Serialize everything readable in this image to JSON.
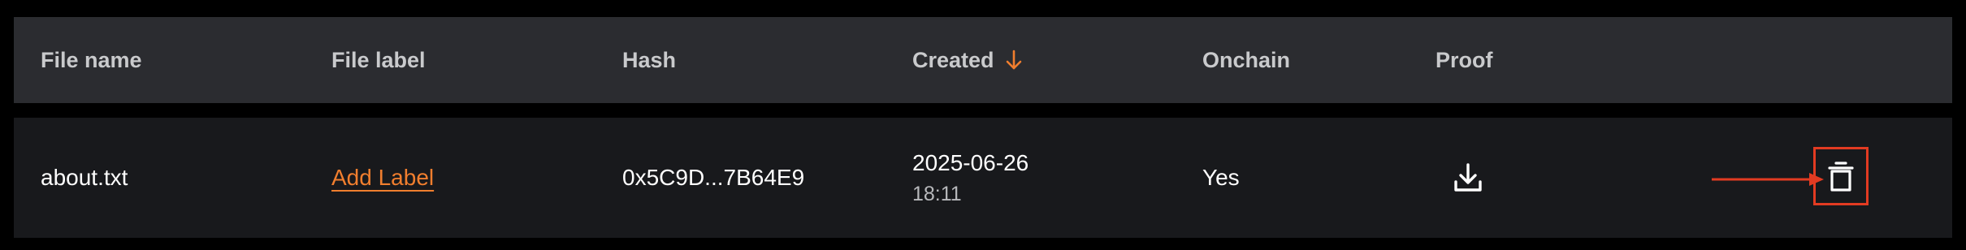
{
  "table": {
    "columns": [
      {
        "label": "File name"
      },
      {
        "label": "File label"
      },
      {
        "label": "Hash"
      },
      {
        "label": "Created",
        "sort": "descending"
      },
      {
        "label": "Onchain"
      },
      {
        "label": "Proof"
      }
    ],
    "rows": [
      {
        "file_name": "about.txt",
        "file_label_action": "Add Label",
        "hash": "0x5C9D...7B64E9",
        "created_date": "2025-06-26",
        "created_time": "18:11",
        "onchain": "Yes",
        "proof_icon": "download-icon",
        "delete_icon": "trash-icon"
      }
    ]
  },
  "colors": {
    "header_bg": "#2b2c30",
    "row_bg": "#18191c",
    "accent": "#f07e2e",
    "highlight": "#e23b22"
  }
}
